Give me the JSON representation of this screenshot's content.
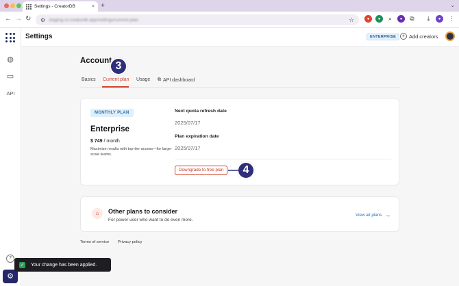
{
  "browser": {
    "tab_title": "Settings - CreatorDB",
    "tab_close": "×",
    "new_tab": "+",
    "url": "staging-ct.creatordb.app/settings/current-plan",
    "traffic_colors": [
      "#ed6a5e",
      "#f5bf4f",
      "#61c554"
    ]
  },
  "header": {
    "title": "Settings",
    "badge": "ENTERPRISE",
    "add_creators": "Add creators"
  },
  "sidebar": {
    "api_label": "API"
  },
  "account": {
    "title": "Account",
    "tabs": [
      {
        "label": "Basics"
      },
      {
        "label": "Current plan",
        "active": true
      },
      {
        "label": "Usage"
      },
      {
        "label": "API dashboard"
      }
    ]
  },
  "plan": {
    "badge": "MONTHLY PLAN",
    "name": "Enterprise",
    "price": "$ 749",
    "period": "/ month",
    "description": "Maximize results with top-tier access—for large-scale teams.",
    "refresh_label": "Next quota refresh date",
    "refresh_value": "2025/07/17",
    "expiration_label": "Plan expiration date",
    "expiration_value": "2025/07/17",
    "downgrade_button": "Downgrade to free plan"
  },
  "other_plans": {
    "title": "Other plans to consider",
    "subtitle": "For power user who want to do even more.",
    "view_all": "View all plans"
  },
  "footer": {
    "terms": "Terms of service",
    "privacy": "Privacy policy"
  },
  "toast": {
    "message": "Your change has been applied."
  },
  "annotations": {
    "step3": "3",
    "step4": "4"
  },
  "colors": {
    "accent_red": "#d0412a",
    "step_badge": "#2f2e7a",
    "link_blue": "#1f73c6"
  }
}
